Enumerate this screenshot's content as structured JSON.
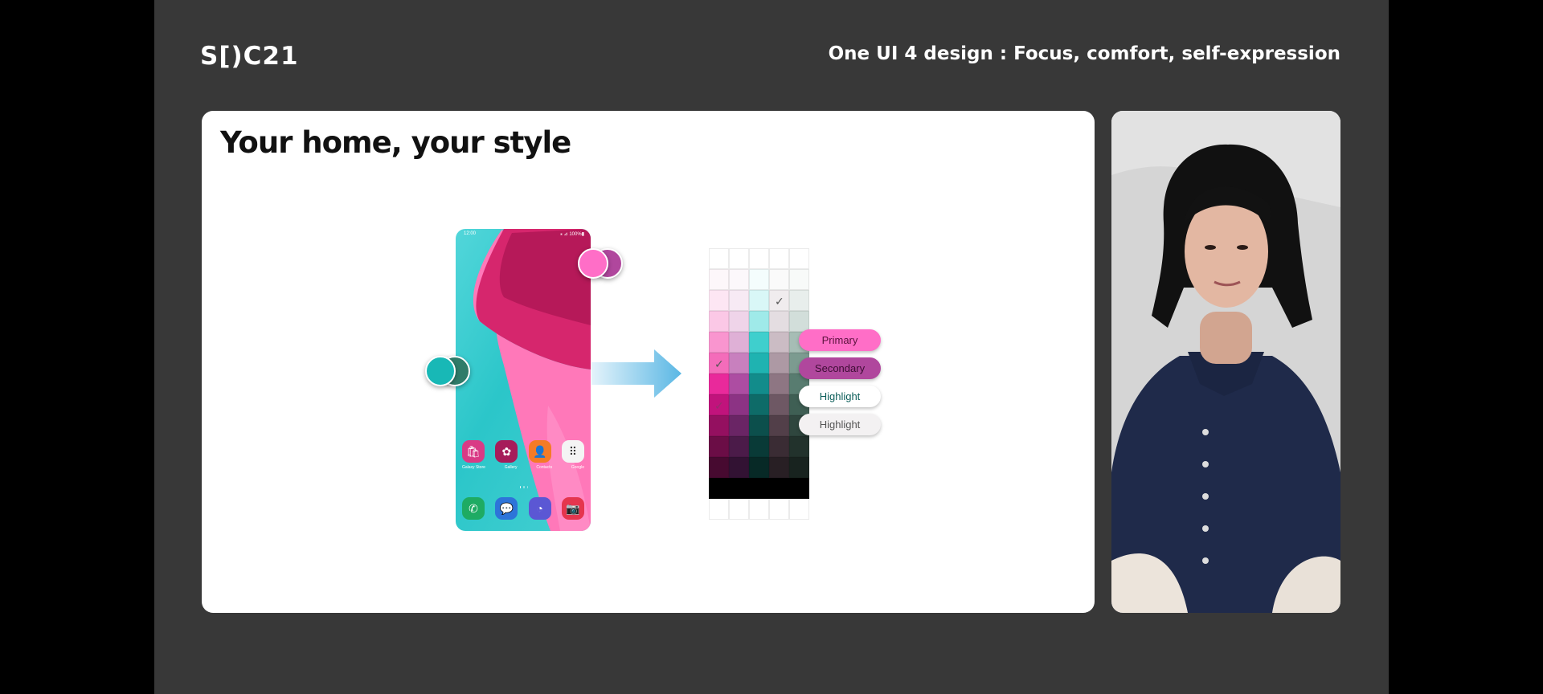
{
  "header": {
    "logo": "S[)C21",
    "title": "One UI 4 design : Focus, comfort, self-expression"
  },
  "slide": {
    "title": "Your home, your style",
    "phone": {
      "status_time": "12:00",
      "status_right": "⁎ ⊿ 100%▮",
      "apps_row1": [
        "Galaxy Store",
        "Gallery",
        "Contacts",
        "Google"
      ],
      "apps_row2": [
        "Phone",
        "Messages",
        "Internet",
        "Camera"
      ]
    },
    "palette": {
      "labels": [
        "Primary",
        "Secondary",
        "Highlight",
        "Highlight"
      ],
      "colors": {
        "primary": "#ff6ec7",
        "secondary": "#b0479d",
        "teal": "#18b8b6",
        "dark_teal": "#2f7c6a"
      }
    }
  }
}
